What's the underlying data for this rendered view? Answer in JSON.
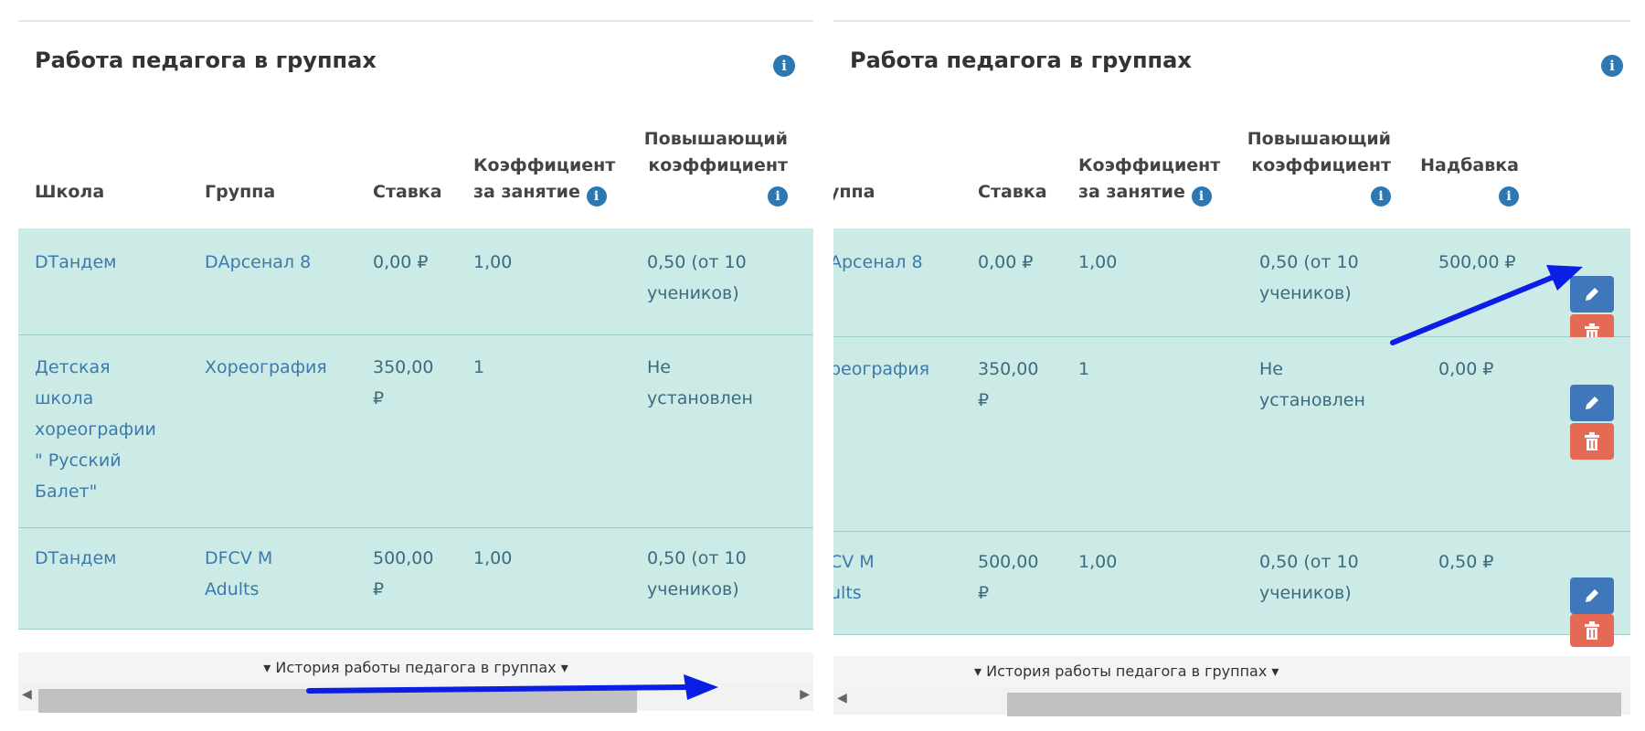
{
  "left": {
    "title": "Работа педагога в группах",
    "headers": {
      "school": "Школа",
      "group": "Группа",
      "rate": "Ставка",
      "coef": [
        "Коэффициент",
        "за занятие"
      ],
      "raise": [
        "Повышающий",
        "коэффициент"
      ]
    },
    "rows": [
      {
        "school": [
          "DТандем"
        ],
        "group": [
          "DАрсенал 8"
        ],
        "rate": [
          "0,00 ₽"
        ],
        "coef": "1,00",
        "raise": [
          "0,50 (от 10",
          "учеников)"
        ]
      },
      {
        "school": [
          "Детская",
          "школа",
          "хореографии",
          "\" Русский",
          "Балет\""
        ],
        "group": [
          "Хореография"
        ],
        "rate": [
          "350,00",
          "₽"
        ],
        "coef": "1",
        "raise": [
          "Не",
          "установлен"
        ]
      },
      {
        "school": [
          "DТандем"
        ],
        "group": [
          "DFCV M",
          "Adults"
        ],
        "rate": [
          "500,00",
          "₽"
        ],
        "coef": "1,00",
        "raise": [
          "0,50 (от 10",
          "учеников)"
        ]
      }
    ],
    "footer": "▾ История работы педагога в группах ▾"
  },
  "right": {
    "title": "Работа педагога в группах",
    "headers": {
      "group": "уппа",
      "rate": "Ставка",
      "coef": [
        "Коэффициент",
        "за занятие"
      ],
      "raise": [
        "Повышающий",
        "коэффициент"
      ],
      "bonus": "Надбавка"
    },
    "rows": [
      {
        "group": [
          "Арсенал 8"
        ],
        "rate": [
          "0,00 ₽"
        ],
        "coef": "1,00",
        "raise": [
          "0,50 (от 10",
          "учеников)"
        ],
        "bonus": "500,00 ₽"
      },
      {
        "group": [
          "реография"
        ],
        "rate": [
          "350,00",
          "₽"
        ],
        "coef": "1",
        "raise": [
          "Не",
          "установлен"
        ],
        "bonus": "0,00 ₽"
      },
      {
        "group": [
          "CV M",
          "ults"
        ],
        "rate": [
          "500,00",
          "₽"
        ],
        "coef": "1,00",
        "raise": [
          "0,50 (от 10",
          "учеников)"
        ],
        "bonus": "0,50 ₽"
      }
    ],
    "footer": "▾ История работы педагога в группах ▾"
  },
  "icons": {
    "info": "info-circle-icon",
    "edit": "pencil-icon",
    "delete": "trash-icon",
    "arrow": "arrow-annotation"
  },
  "colors": {
    "row_bg": "#cdebe6",
    "link": "#3c7aa9",
    "info_blue": "#2b78b3",
    "edit_btn": "#3e78ba",
    "delete_btn": "#e56a55",
    "annotation_arrow": "#0a1ee6"
  }
}
